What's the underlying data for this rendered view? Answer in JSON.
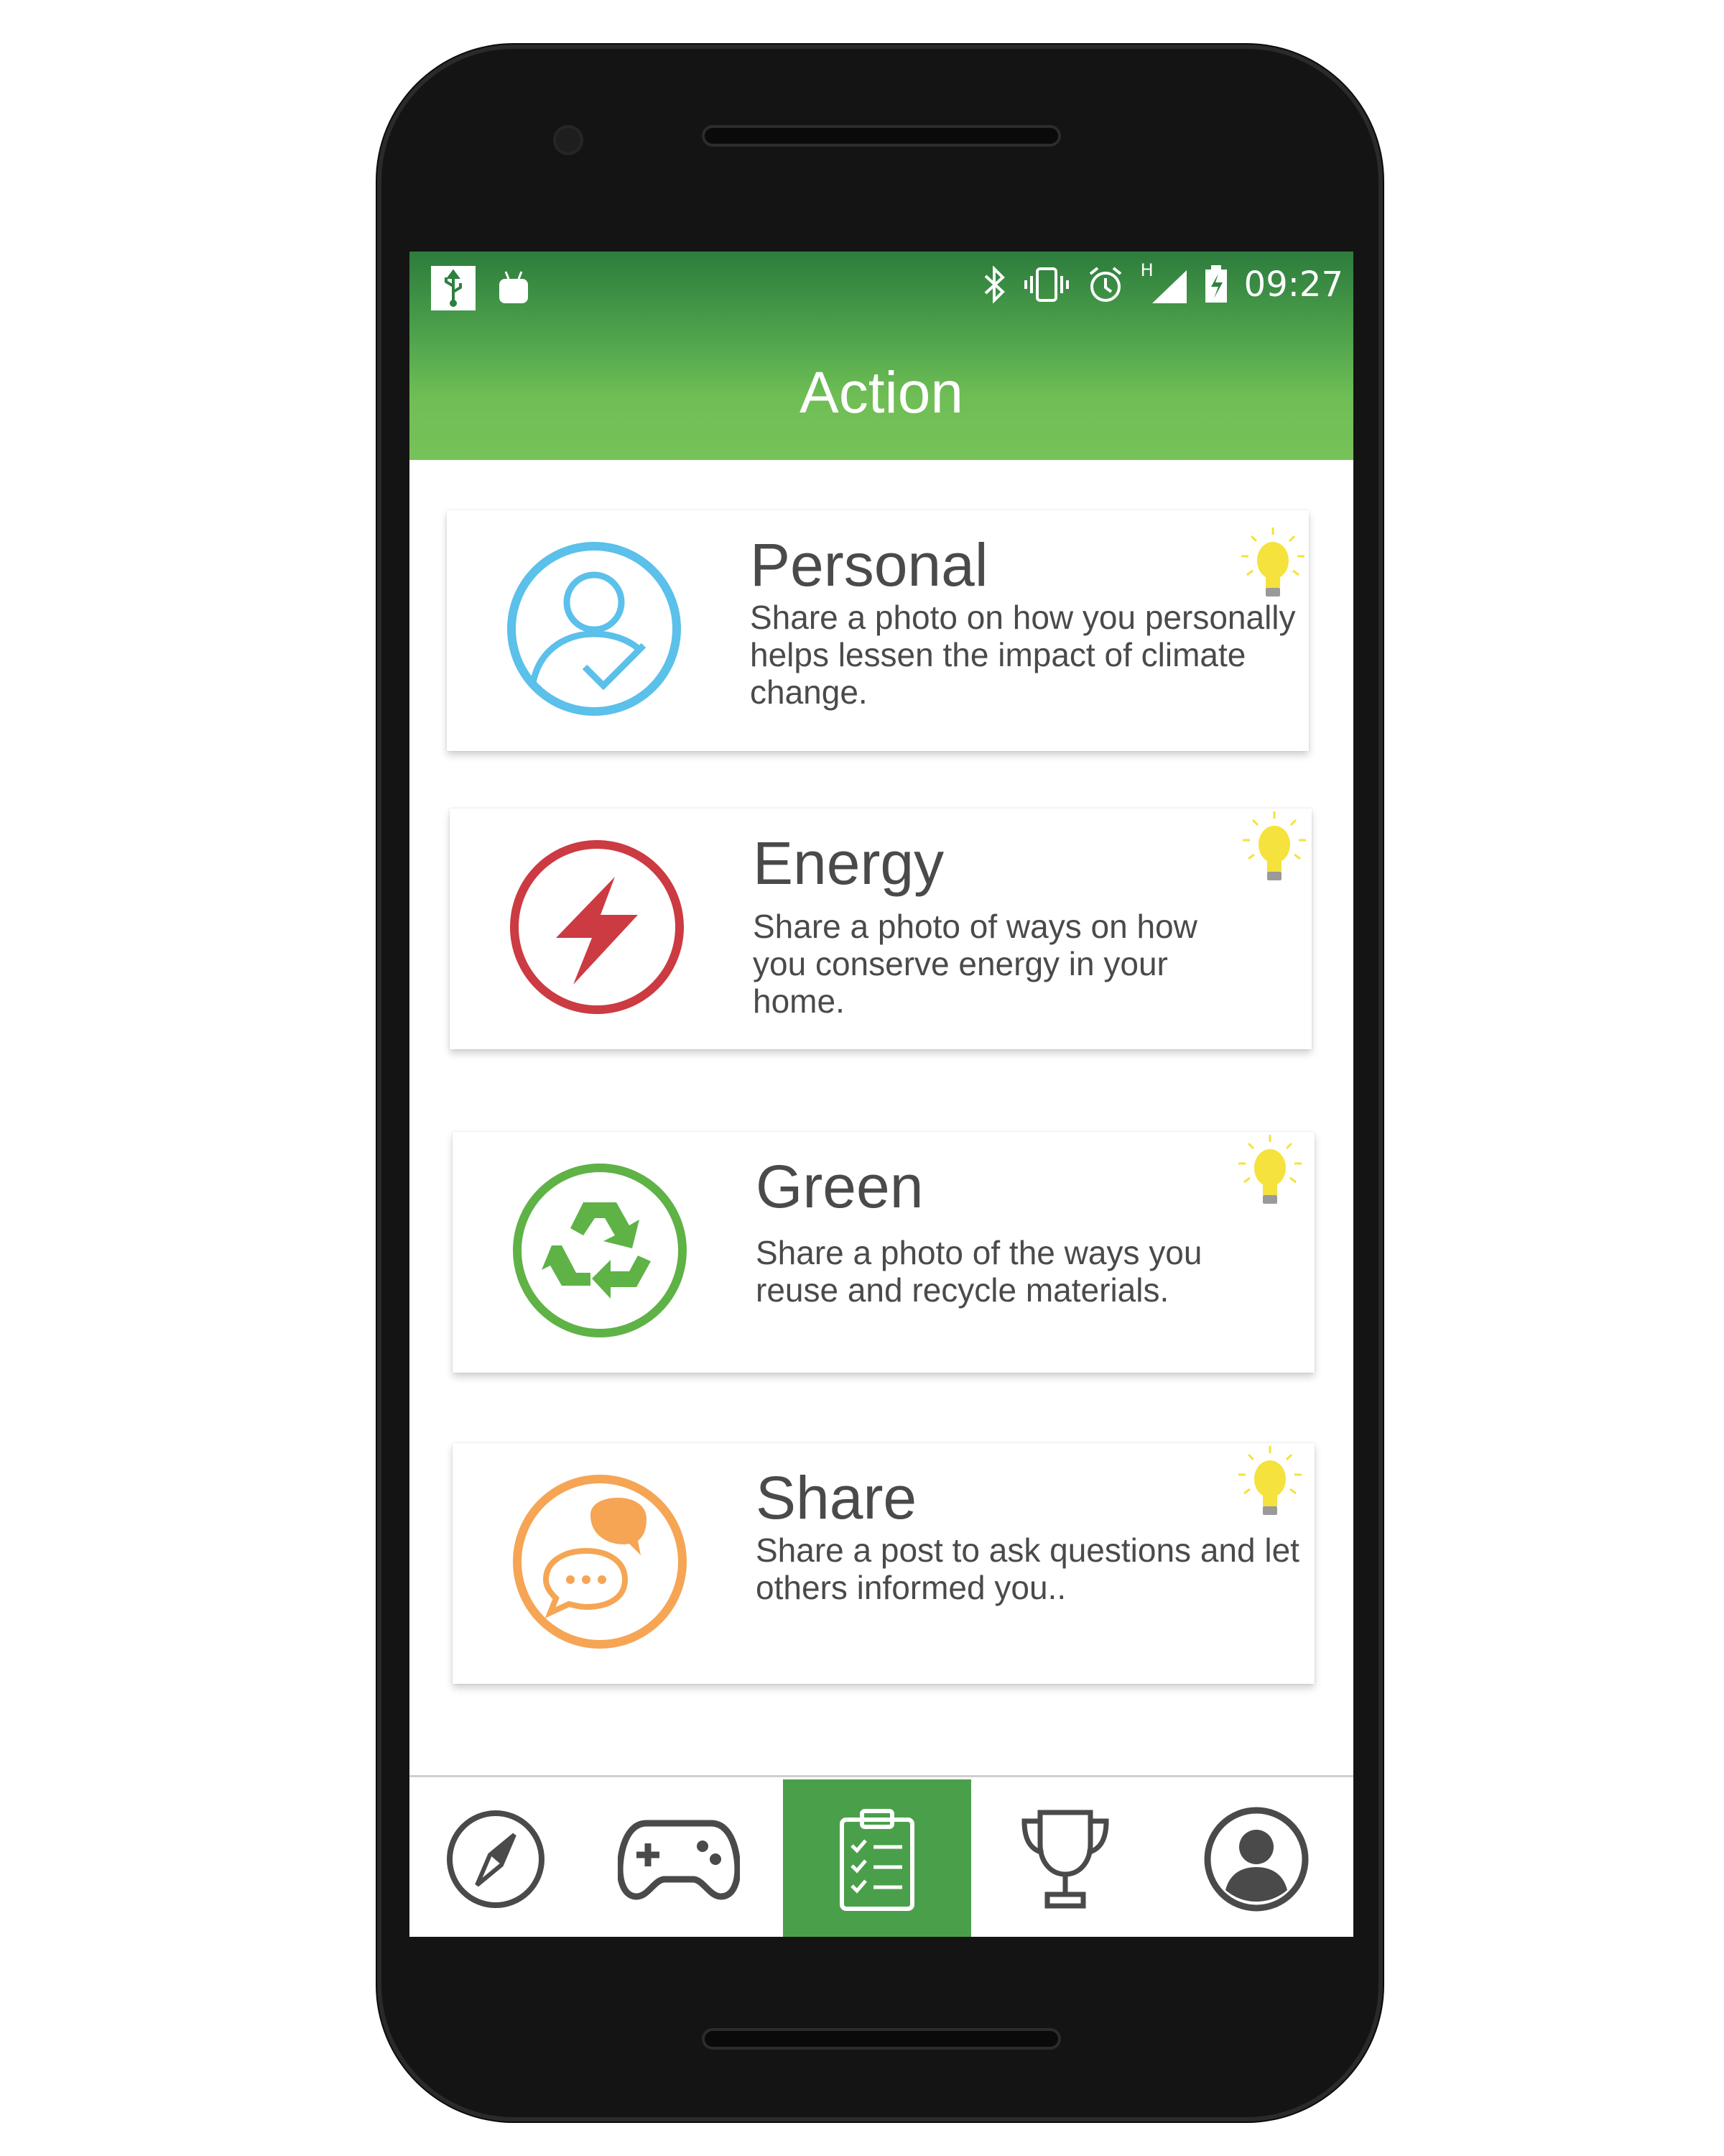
{
  "status_bar": {
    "time": "09:27",
    "icons": [
      "usb-icon",
      "android-icon",
      "bluetooth-icon",
      "vibrate-icon",
      "alarm-icon",
      "signal-icon",
      "battery-charging-icon"
    ],
    "network_label": "H"
  },
  "header": {
    "title": "Action"
  },
  "cards": [
    {
      "title": "Personal",
      "description": "Share a photo on how you personally helps lessen the impact of climate change.",
      "icon": "person-check-icon",
      "color": "#5bc0ea"
    },
    {
      "title": "Energy",
      "description": "Share a photo of ways on how you conserve energy in your home.",
      "icon": "lightning-icon",
      "color": "#cc3a42"
    },
    {
      "title": "Green",
      "description": "Share a photo of the ways you reuse and recycle materials.",
      "icon": "recycle-icon",
      "color": "#5fb246"
    },
    {
      "title": "Share",
      "description": "Share a post to ask questions and let others informed you..",
      "icon": "chat-bubbles-icon",
      "color": "#f5a554"
    }
  ],
  "bulb_color": "#f5e23c",
  "bottom_nav": [
    {
      "name": "explore",
      "icon": "compass-icon",
      "active": false
    },
    {
      "name": "games",
      "icon": "gamepad-icon",
      "active": false
    },
    {
      "name": "action",
      "icon": "clipboard-checklist-icon",
      "active": true
    },
    {
      "name": "rankings",
      "icon": "trophy-icon",
      "active": false
    },
    {
      "name": "profile",
      "icon": "user-avatar-icon",
      "active": false
    }
  ],
  "colors": {
    "primary_green": "#4aa04a",
    "header_dark": "#2d7c3d",
    "text": "#4a4a4a"
  }
}
